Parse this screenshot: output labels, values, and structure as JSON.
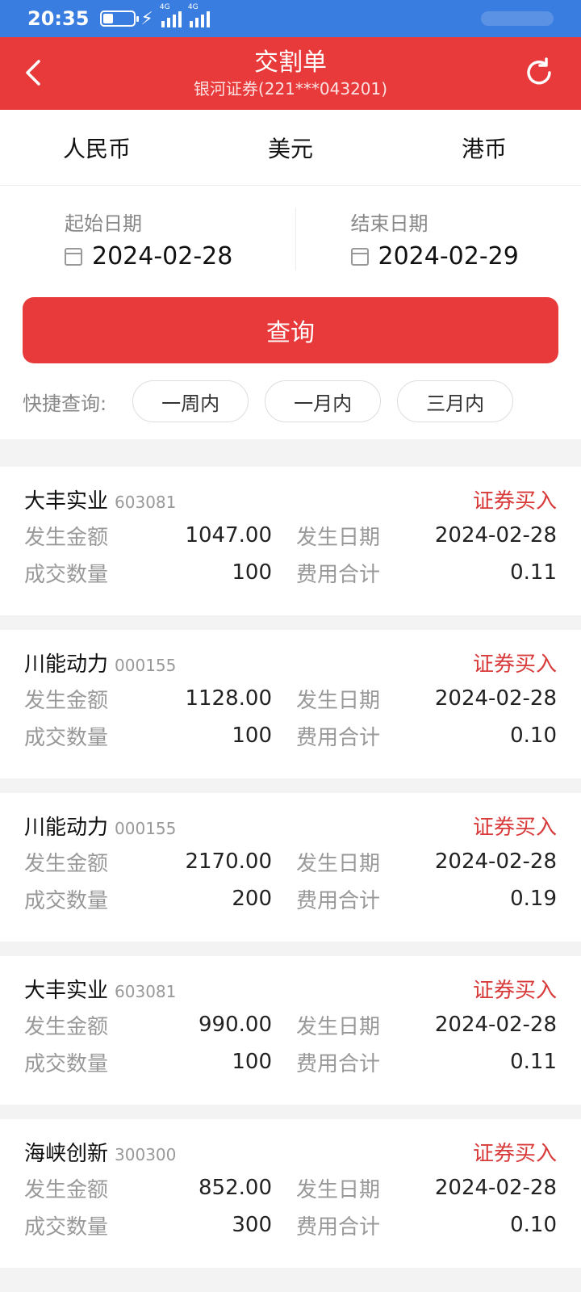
{
  "status": {
    "time": "20:35",
    "network1": "4G",
    "network2": "4G"
  },
  "header": {
    "title": "交割单",
    "subtitle": "银河证券(221***043201)"
  },
  "tabs": [
    "人民币",
    "美元",
    "港币"
  ],
  "dates": {
    "start_label": "起始日期",
    "start_value": "2024-02-28",
    "end_label": "结束日期",
    "end_value": "2024-02-29"
  },
  "query_label": "查询",
  "quick": {
    "label": "快捷查询:",
    "options": [
      "一周内",
      "一月内",
      "三月内"
    ]
  },
  "labels": {
    "amount": "发生金额",
    "date": "发生日期",
    "qty": "成交数量",
    "fee": "费用合计"
  },
  "records": [
    {
      "name": "大丰实业",
      "code": "603081",
      "type": "证券买入",
      "amount": "1047.00",
      "date": "2024-02-28",
      "qty": "100",
      "fee": "0.11"
    },
    {
      "name": "川能动力",
      "code": "000155",
      "type": "证券买入",
      "amount": "1128.00",
      "date": "2024-02-28",
      "qty": "100",
      "fee": "0.10"
    },
    {
      "name": "川能动力",
      "code": "000155",
      "type": "证券买入",
      "amount": "2170.00",
      "date": "2024-02-28",
      "qty": "200",
      "fee": "0.19"
    },
    {
      "name": "大丰实业",
      "code": "603081",
      "type": "证券买入",
      "amount": "990.00",
      "date": "2024-02-28",
      "qty": "100",
      "fee": "0.11"
    },
    {
      "name": "海峡创新",
      "code": "300300",
      "type": "证券买入",
      "amount": "852.00",
      "date": "2024-02-28",
      "qty": "300",
      "fee": "0.10"
    }
  ],
  "colors": {
    "brand": "#e83a3a",
    "statusbar": "#3a7de0",
    "type_text": "#d83a3a"
  }
}
